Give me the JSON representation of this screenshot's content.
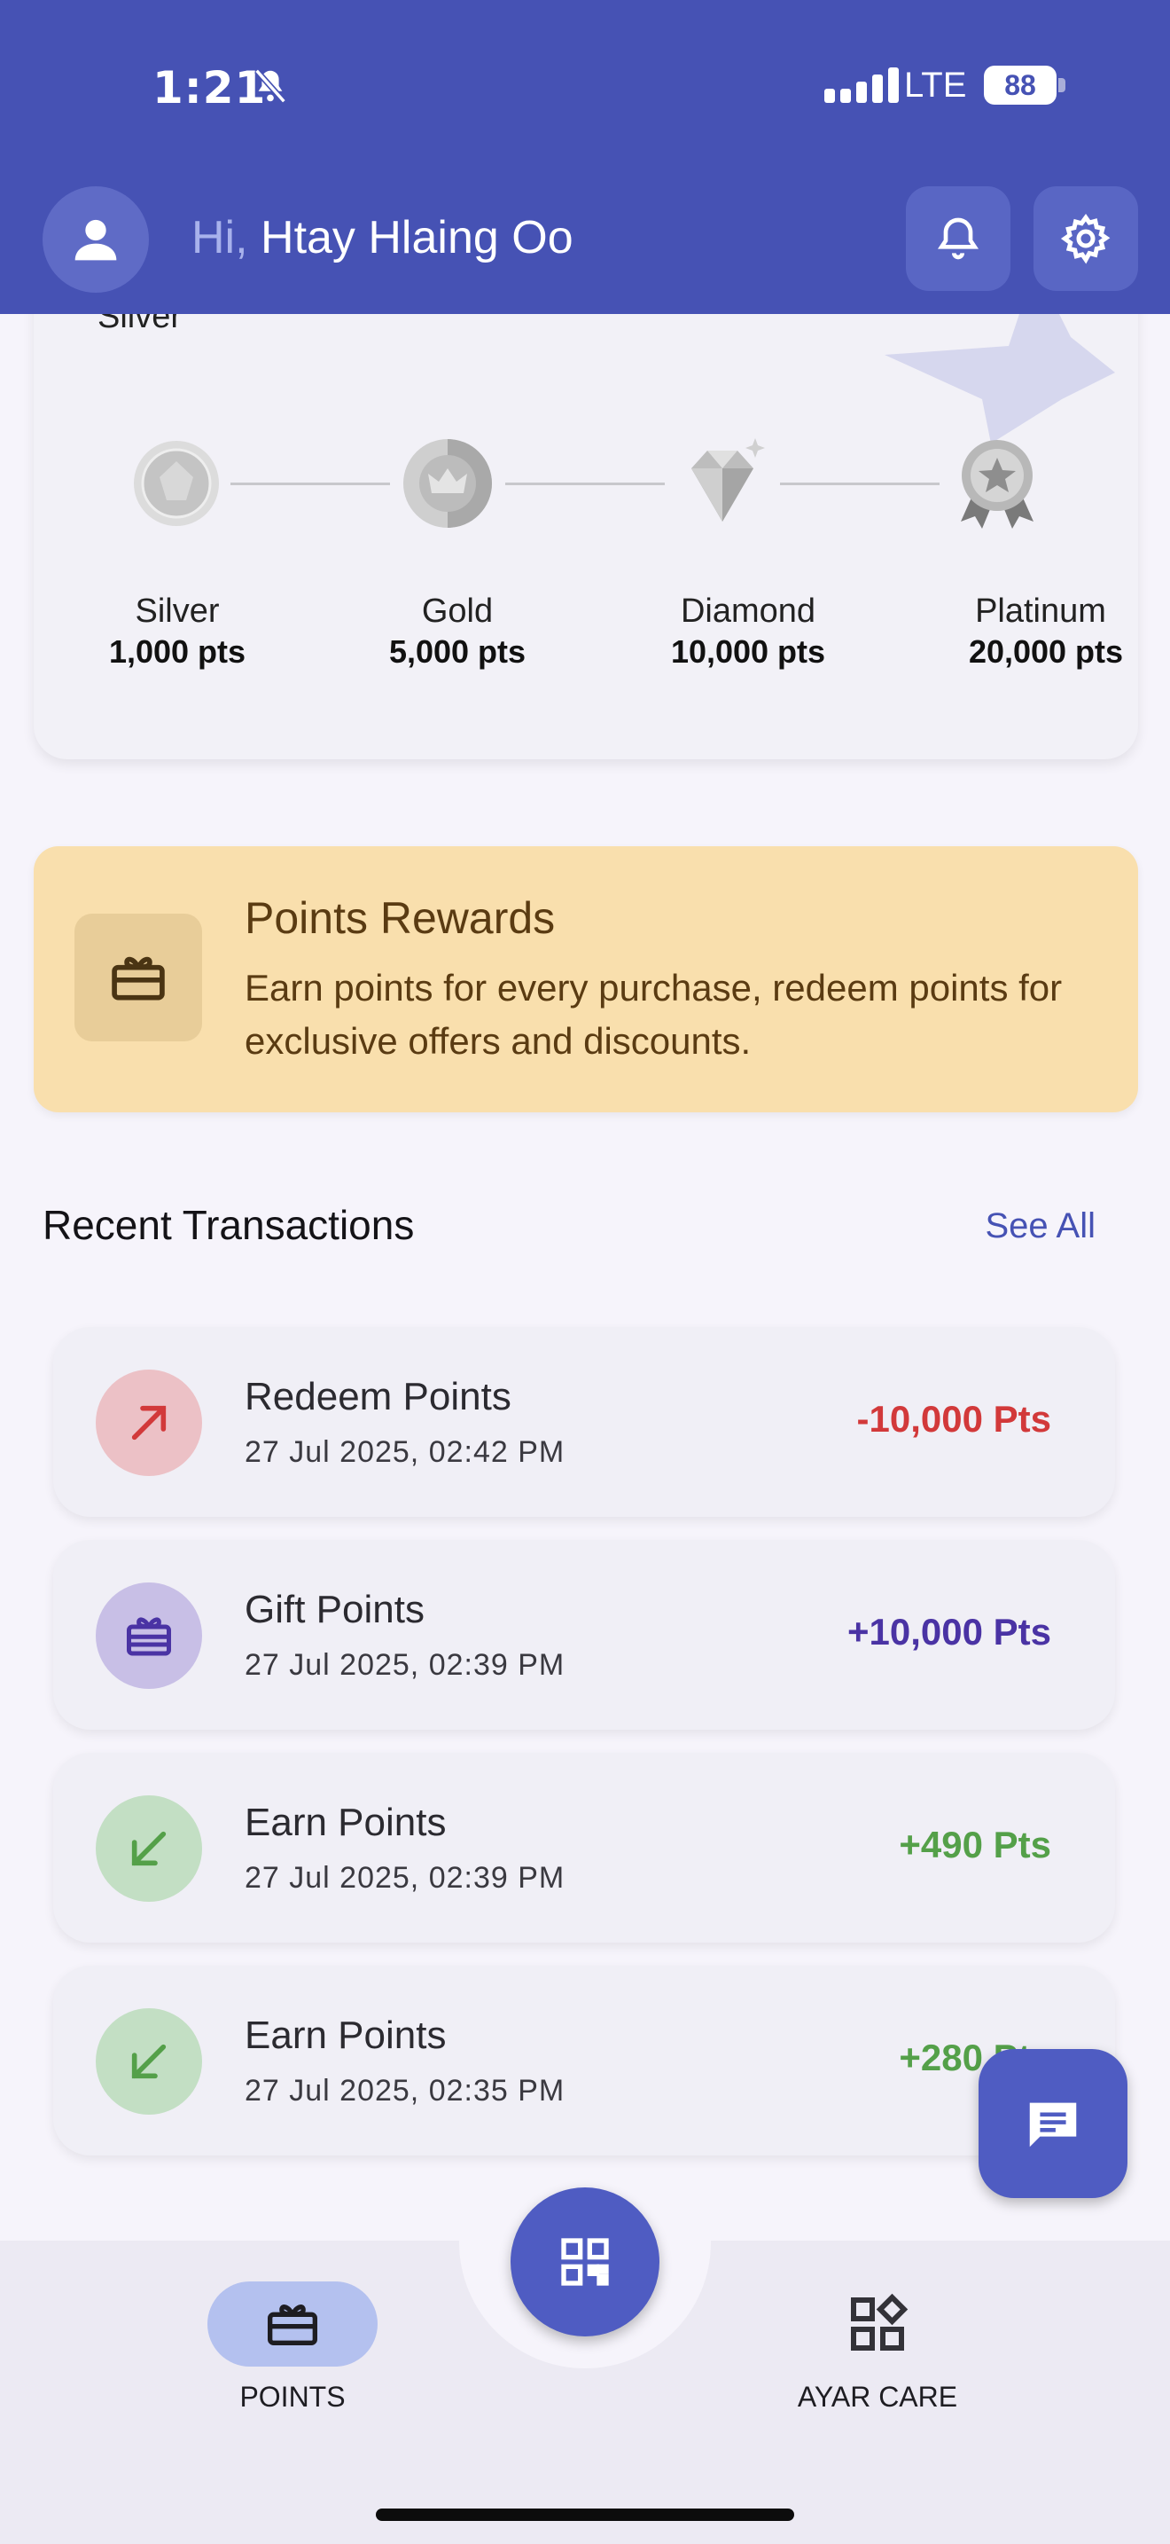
{
  "status_bar": {
    "time": "1:21",
    "network": "LTE",
    "battery": "88"
  },
  "header": {
    "greeting": "Hi,",
    "user_name": "Htay Hlaing Oo"
  },
  "tiers": {
    "current_label": "Silver",
    "levels": [
      {
        "name": "Silver",
        "points": "1,000 pts"
      },
      {
        "name": "Gold",
        "points": "5,000 pts"
      },
      {
        "name": "Diamond",
        "points": "10,000 pts"
      },
      {
        "name": "Platinum",
        "points": "20,000 pts"
      }
    ]
  },
  "rewards": {
    "title": "Points Rewards",
    "description": "Earn points for every purchase, redeem points for exclusive offers and discounts."
  },
  "recent": {
    "title": "Recent Transactions",
    "see_all": "See All",
    "items": [
      {
        "title": "Redeem Points",
        "date": "27 Jul 2025, 02:42 PM",
        "amount": "-10,000 Pts",
        "kind": "redeem",
        "color": "#d2393a"
      },
      {
        "title": "Gift Points",
        "date": "27 Jul 2025, 02:39 PM",
        "amount": "+10,000 Pts",
        "kind": "gift",
        "color": "#4a33a4"
      },
      {
        "title": "Earn Points",
        "date": "27 Jul 2025, 02:39 PM",
        "amount": "+490 Pts",
        "kind": "earn",
        "color": "#54a049"
      },
      {
        "title": "Earn Points",
        "date": "27 Jul 2025, 02:35 PM",
        "amount": "+280 Pts",
        "kind": "earn",
        "color": "#54a049"
      }
    ]
  },
  "bottom_nav": {
    "points": "POINTS",
    "ayar_care": "AYAR CARE"
  },
  "colors": {
    "brand": "#4652b4",
    "fab": "#4f5cc2",
    "rewards_bg": "#f9dfad"
  }
}
